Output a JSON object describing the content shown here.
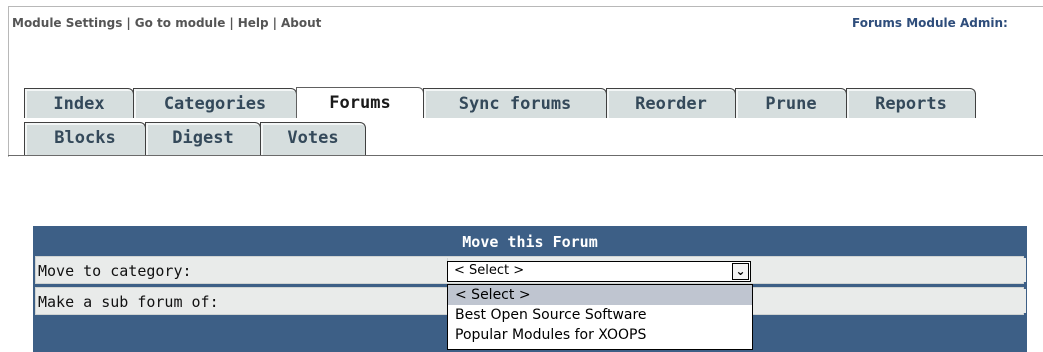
{
  "top_links": [
    "Module Settings",
    "Go to module",
    "Help",
    "About"
  ],
  "admin_title": "Forums Module Admin:",
  "tabs_row1": [
    "Index",
    "Categories",
    "Forums",
    "Sync forums",
    "Reorder",
    "Prune",
    "Reports"
  ],
  "tabs_row2": [
    "Blocks",
    "Digest",
    "Votes"
  ],
  "active_tab": "Forums",
  "panel": {
    "title": "Move this Forum",
    "move_label": "Move to category:",
    "sub_label": "Make a sub forum of:",
    "select_value": "< Select >",
    "dropdown_arrow": "chevron-down-icon",
    "options": [
      "< Select >",
      "Best Open Source Software",
      "Popular Modules for XOOPS"
    ]
  },
  "colors": {
    "panel_bg": "#3d5f86",
    "tab_bg": "#d6dede",
    "row_bg": "#e9ebea",
    "admin_title": "#2e4d7b"
  }
}
